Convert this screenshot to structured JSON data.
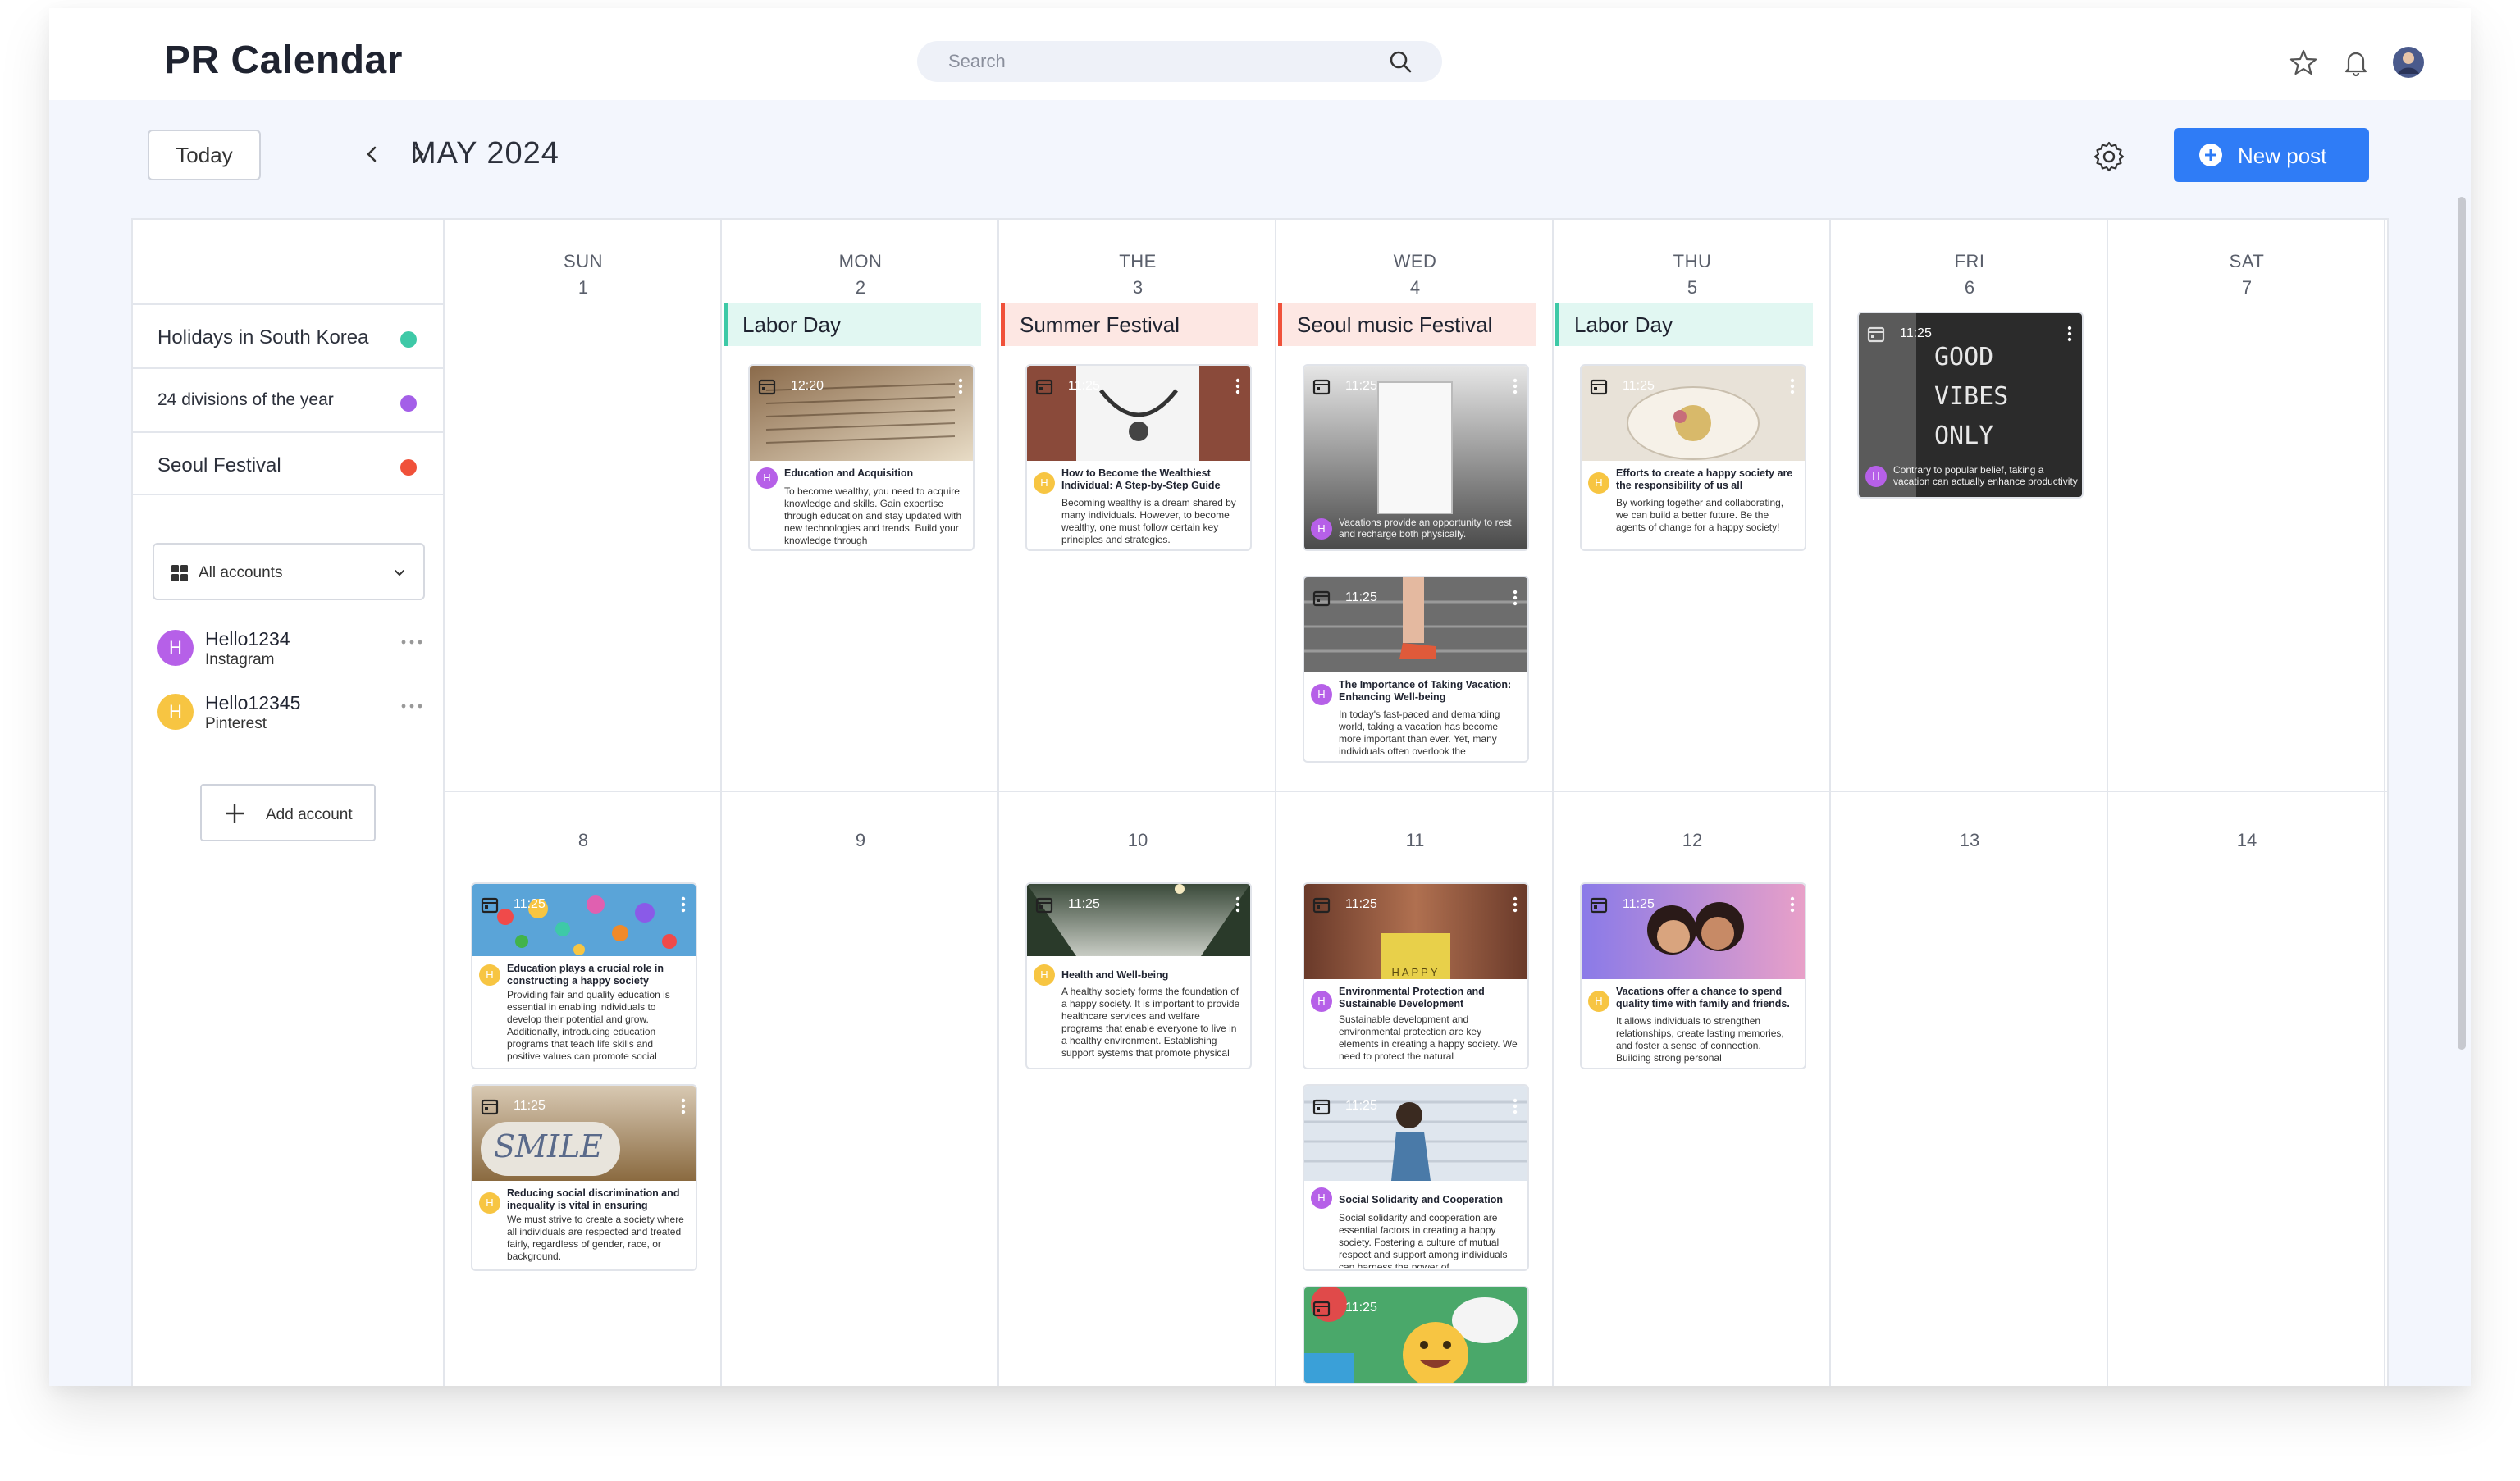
{
  "app": {
    "title": "PR Calendar"
  },
  "search": {
    "placeholder": "Search"
  },
  "toolbar": {
    "today": "Today",
    "month": "MAY 2024",
    "new_post": "New post"
  },
  "calendars": [
    {
      "name": "Holidays in South Korea",
      "color": "#3ec9a7"
    },
    {
      "name": "24 divisions of the year",
      "color": "#a45fe8"
    },
    {
      "name": "Seoul Festival",
      "color": "#f0513a"
    }
  ],
  "accounts_filter": "All accounts",
  "accounts": [
    {
      "initial": "H",
      "name": "Hello1234",
      "platform": "Instagram",
      "color": "#b660e8"
    },
    {
      "initial": "H",
      "name": "Hello12345",
      "platform": "Pinterest",
      "color": "#f7c542"
    }
  ],
  "add_account": "Add account",
  "weekdays": [
    "SUN",
    "MON",
    "THE",
    "WED",
    "THU",
    "FRI",
    "SAT"
  ],
  "week1_dates": [
    "1",
    "2",
    "3",
    "4",
    "5",
    "6",
    "7"
  ],
  "week2_dates": [
    "8",
    "9",
    "10",
    "11",
    "12",
    "13",
    "14"
  ],
  "events": [
    {
      "label": "Labor Day",
      "bg": "#e1f7f2",
      "accent": "#3ec9a7"
    },
    {
      "label": "Summer Festival",
      "bg": "#fde7e3",
      "accent": "#f0513a"
    },
    {
      "label": "Seoul music Festival",
      "bg": "#fde7e3",
      "accent": "#f0513a"
    },
    {
      "label": "Labor Day",
      "bg": "#e1f7f2",
      "accent": "#3ec9a7"
    }
  ],
  "posts": {
    "mon2": {
      "time": "12:20",
      "initial": "H",
      "title": "Education and Acquisition",
      "body": "To become wealthy, you need to acquire knowledge and skills. Gain expertise through education and stay updated with new technologies and trends. Build your knowledge through"
    },
    "tue3": {
      "time": "11:25",
      "initial": "H",
      "title": "How to Become the Wealthiest Individual: A Step-by-Step Guide",
      "body": "Becoming wealthy is a dream shared by many individuals. However, to become wealthy, one must follow certain key principles and strategies."
    },
    "wed4a": {
      "time": "11:25",
      "initial": "H",
      "caption": "Vacations provide an opportunity to rest and recharge both physically."
    },
    "wed4b": {
      "time": "11:25",
      "initial": "H",
      "title": "The Importance of Taking Vacation: Enhancing Well-being",
      "body": "In today's fast-paced and demanding world, taking a vacation has become more important than ever. Yet, many individuals often overlook the"
    },
    "thu5": {
      "time": "11:25",
      "initial": "H",
      "title": "Efforts to create a happy society are the responsibility of us all",
      "body": "By working together and collaborating, we can build a better future. Be the agents of change for a happy society!"
    },
    "fri6": {
      "time": "11:25",
      "initial": "H",
      "sign": "GOOD VIBES ONLY",
      "caption": "Contrary to popular belief, taking a vacation can actually enhance productivity"
    },
    "sun8a": {
      "time": "11:25",
      "initial": "H",
      "title": "Education plays a crucial role in constructing a happy society",
      "body": "Providing fair and quality education is essential in enabling individuals to develop their potential and grow. Additionally, introducing education programs that teach life skills and positive values can promote social"
    },
    "sun8b": {
      "time": "11:25",
      "initial": "H",
      "stone": "SMILE",
      "title": "Reducing social discrimination and inequality is vital in ensuring",
      "body": "We must strive to create a society where all individuals are respected and treated fairly, regardless of gender, race, or background."
    },
    "tue10": {
      "time": "11:25",
      "initial": "H",
      "title": "Health and Well-being",
      "body": "A healthy society forms the foundation of a happy society. It is important to provide healthcare services and welfare programs that enable everyone to live in a healthy environment. Establishing support systems that promote physical"
    },
    "wed11a": {
      "time": "11:25",
      "initial": "H",
      "book": "HAPPY",
      "title": "Environmental Protection and Sustainable Development",
      "body": "Sustainable development and environmental protection are key elements in creating a happy society. We need to protect the natural"
    },
    "wed11b": {
      "time": "11:25",
      "initial": "H",
      "title": "Social Solidarity and Cooperation",
      "body": "Social solidarity and cooperation are essential factors in creating a happy society. Fostering a culture of mutual respect and support among individuals can harness the power of"
    },
    "wed11c": {
      "time": "11:25"
    },
    "thu12": {
      "time": "11:25",
      "initial": "H",
      "title": "Vacations offer a chance to spend quality time with family and friends.",
      "body": "It allows individuals to strengthen relationships, create lasting memories, and foster a sense of connection. Building strong personal"
    }
  }
}
